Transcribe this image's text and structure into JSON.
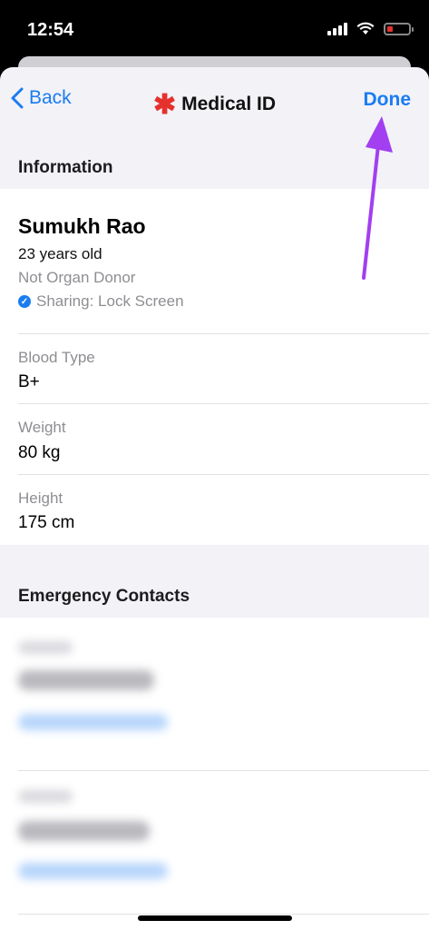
{
  "status_bar": {
    "time": "12:54"
  },
  "nav": {
    "back_label": "Back",
    "title": "Medical ID",
    "done_label": "Done"
  },
  "info": {
    "header": "Information",
    "name": "Sumukh Rao",
    "age": "23 years old",
    "organ_donor": "Not Organ Donor",
    "sharing": "Sharing: Lock Screen"
  },
  "fields": [
    {
      "label": "Blood Type",
      "value": "B+"
    },
    {
      "label": "Weight",
      "value": "80 kg"
    },
    {
      "label": "Height",
      "value": "175 cm"
    }
  ],
  "emergency": {
    "header": "Emergency Contacts"
  },
  "colors": {
    "accent": "#1a7cf2",
    "medical_red": "#e5312e",
    "annotation_arrow": "#a23ff0"
  }
}
